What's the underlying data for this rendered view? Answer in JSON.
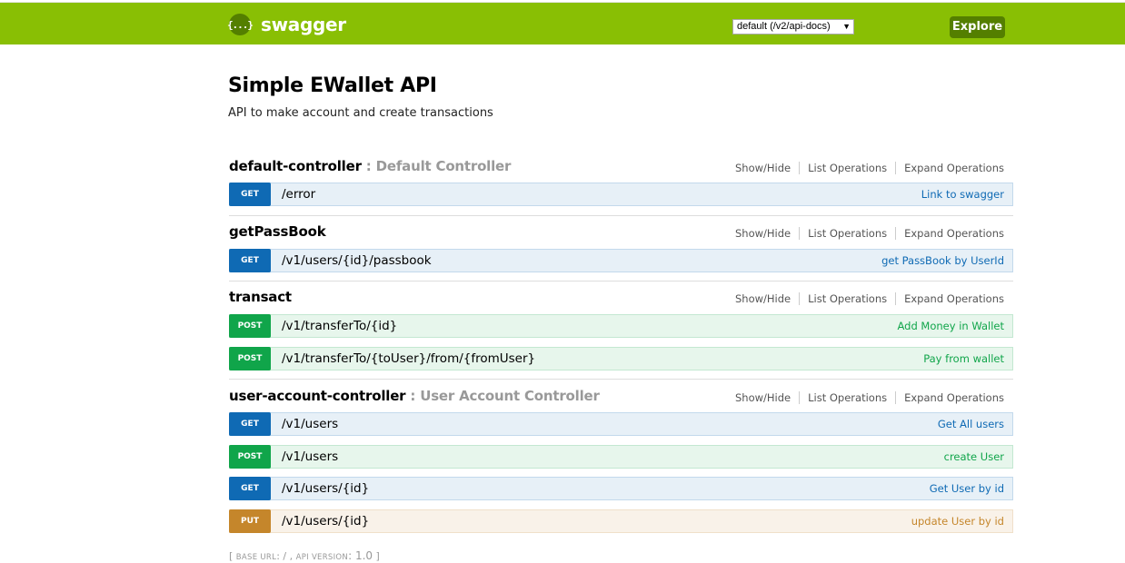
{
  "header": {
    "logo_text": "swagger",
    "logo_glyph": "{...}",
    "spec_select": "default (/v2/api-docs)",
    "explore_label": "Explore",
    "brand_color": "#89bf04"
  },
  "info": {
    "title": "Simple EWallet API",
    "description": "API to make account and create transactions"
  },
  "resource_links": {
    "show_hide": "Show/Hide",
    "list_ops": "List Operations",
    "expand_ops": "Expand Operations"
  },
  "resources": [
    {
      "name": "default-controller",
      "desc": " : Default Controller",
      "ops": [
        {
          "method": "GET",
          "path": "/error",
          "summary": "Link to swagger"
        }
      ]
    },
    {
      "name": "getPassBook",
      "desc": "",
      "ops": [
        {
          "method": "GET",
          "path": "/v1/users/{id}/passbook",
          "summary": "get PassBook by UserId"
        }
      ]
    },
    {
      "name": "transact",
      "desc": "",
      "ops": [
        {
          "method": "POST",
          "path": "/v1/transferTo/{id}",
          "summary": "Add Money in Wallet"
        },
        {
          "method": "POST",
          "path": "/v1/transferTo/{toUser}/from/{fromUser}",
          "summary": "Pay from wallet"
        }
      ]
    },
    {
      "name": "user-account-controller",
      "desc": " : User Account Controller",
      "ops": [
        {
          "method": "GET",
          "path": "/v1/users",
          "summary": "Get All users"
        },
        {
          "method": "POST",
          "path": "/v1/users",
          "summary": "create User"
        },
        {
          "method": "GET",
          "path": "/v1/users/{id}",
          "summary": "Get User by id"
        },
        {
          "method": "PUT",
          "path": "/v1/users/{id}",
          "summary": "update User by id"
        }
      ]
    }
  ],
  "footer": {
    "open": "[ ",
    "base_url_label": "base url",
    "base_url_value": ": / , ",
    "api_version_label": "api version",
    "api_version_value": ": 1.0",
    "close": " ]"
  }
}
